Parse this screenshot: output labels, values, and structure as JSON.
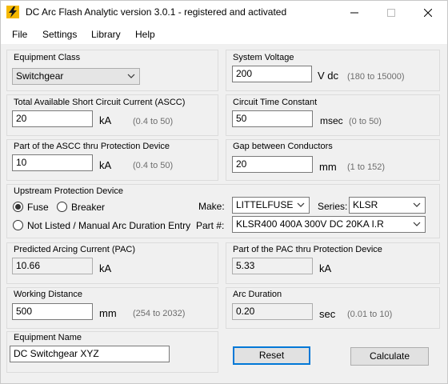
{
  "window": {
    "title": "DC Arc Flash Analytic version 3.0.1 - registered and activated",
    "minimize_glyph": "—",
    "maximize_glyph": "☐",
    "close_glyph": "✕"
  },
  "menu": {
    "file": "File",
    "settings": "Settings",
    "library": "Library",
    "help": "Help"
  },
  "equipment_class": {
    "label": "Equipment Class",
    "value": "Switchgear"
  },
  "system_voltage": {
    "label": "System Voltage",
    "value": "200",
    "unit": "V dc",
    "range": "(180 to 15000)"
  },
  "ascc": {
    "label": "Total Available Short Circuit Current (ASCC)",
    "value": "20",
    "unit": "kA",
    "range": "(0.4 to 50)"
  },
  "time_constant": {
    "label": "Circuit Time Constant",
    "value": "50",
    "unit": "msec",
    "range": "(0 to 50)"
  },
  "ascc_part": {
    "label": "Part of the ASCC thru Protection Device",
    "value": "10",
    "unit": "kA",
    "range": "(0.4 to 50)"
  },
  "gap": {
    "label": "Gap between Conductors",
    "value": "20",
    "unit": "mm",
    "range": "(1 to 152)"
  },
  "upstream": {
    "label": "Upstream Protection Device",
    "fuse": "Fuse",
    "breaker": "Breaker",
    "not_listed": "Not Listed / Manual Arc Duration Entry",
    "make_label": "Make:",
    "make_value": "LITTELFUSE",
    "series_label": "Series:",
    "series_value": "KLSR",
    "part_label": "Part #:",
    "part_value": "KLSR400 400A 300V DC 20KA I.R",
    "selected": "fuse"
  },
  "pac": {
    "label": "Predicted Arcing Current (PAC)",
    "value": "10.66",
    "unit": "kA"
  },
  "pac_part": {
    "label": "Part of the PAC thru Protection Device",
    "value": "5.33",
    "unit": "kA"
  },
  "working_distance": {
    "label": "Working Distance",
    "value": "500",
    "unit": "mm",
    "range": "(254 to 2032)"
  },
  "arc_duration": {
    "label": "Arc Duration",
    "value": "0.20",
    "unit": "sec",
    "range": "(0.01 to 10)"
  },
  "equipment_name": {
    "label": "Equipment Name",
    "value": "DC Switchgear XYZ"
  },
  "buttons": {
    "reset": "Reset",
    "calculate": "Calculate"
  },
  "colors": {
    "accent": "#0078d7",
    "client_bg": "#f0f0f0",
    "range_text": "#6d6d6d"
  }
}
